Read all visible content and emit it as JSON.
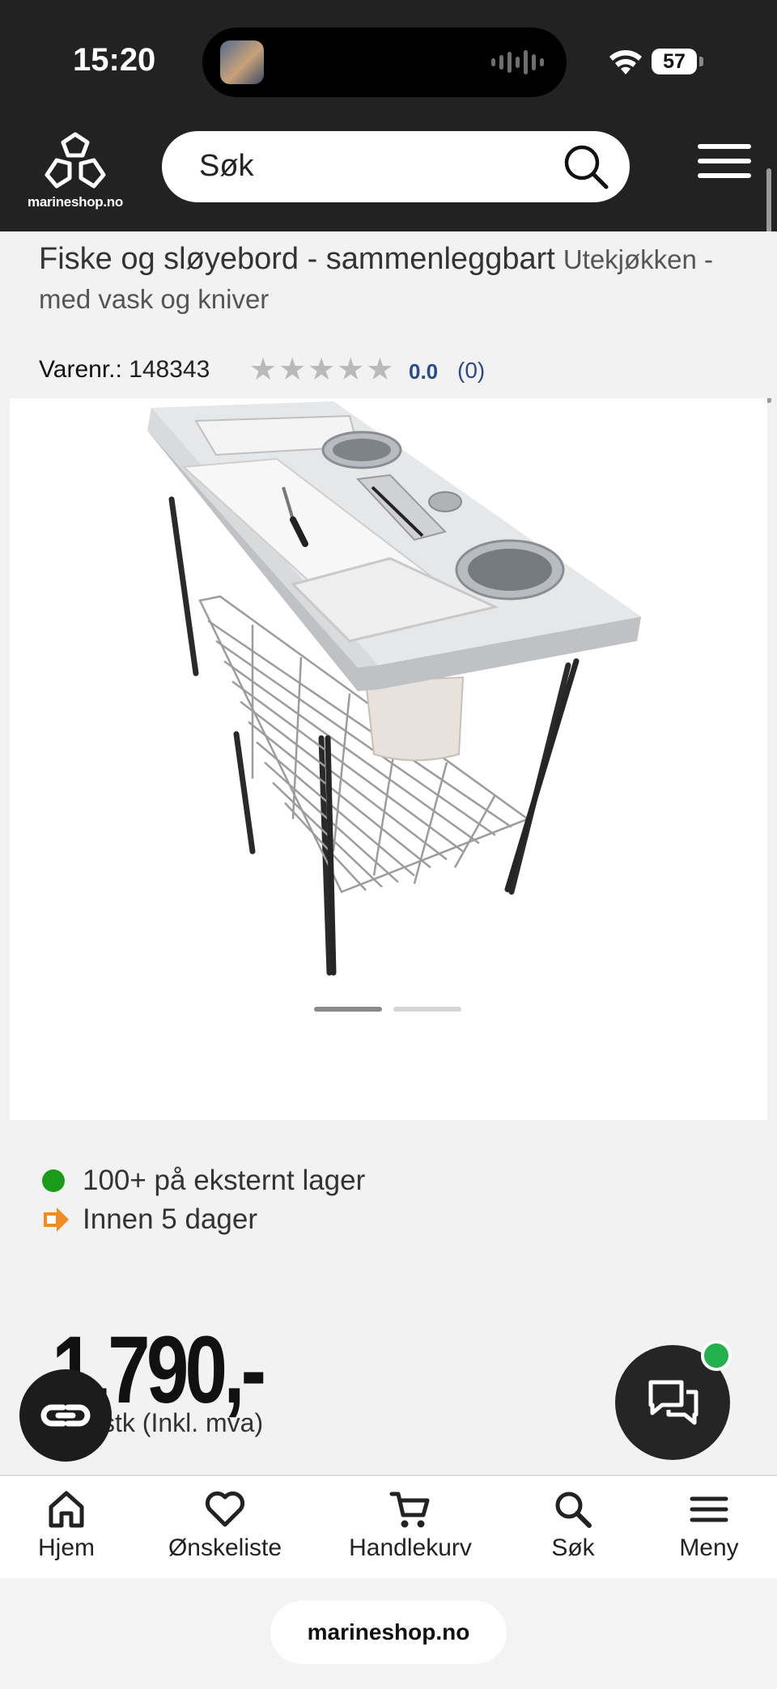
{
  "status_bar": {
    "time": "15:20",
    "battery": "57"
  },
  "header": {
    "logo_text": "marineshop.no",
    "search_placeholder": "Søk"
  },
  "product": {
    "title": "Fiske og sløyebord - sammenleggbart",
    "subtitle": "Utekjøkken - med vask og kniver",
    "sku_label": "Varenr.:",
    "sku": "148343",
    "rating": "0.0",
    "review_count": "(0)",
    "stars_filled": 0,
    "stars_total": 5,
    "image_count": 2,
    "active_image": 1
  },
  "stock": {
    "availability": "100+ på eksternt lager",
    "delivery": "Innen 5 dager",
    "availability_color": "#1a9b1a",
    "delivery_icon_color": "#f28c1e"
  },
  "price": {
    "amount": "1.790,-",
    "unit": "stk (Inkl. mva)"
  },
  "chat": {
    "online_color": "#22b14c"
  },
  "bottom_nav": [
    {
      "label": "Hjem",
      "icon": "home-icon"
    },
    {
      "label": "Ønskeliste",
      "icon": "heart-icon"
    },
    {
      "label": "Handlekurv",
      "icon": "cart-icon"
    },
    {
      "label": "Søk",
      "icon": "search-icon"
    },
    {
      "label": "Meny",
      "icon": "menu-icon"
    }
  ],
  "browser": {
    "url": "marineshop.no"
  }
}
